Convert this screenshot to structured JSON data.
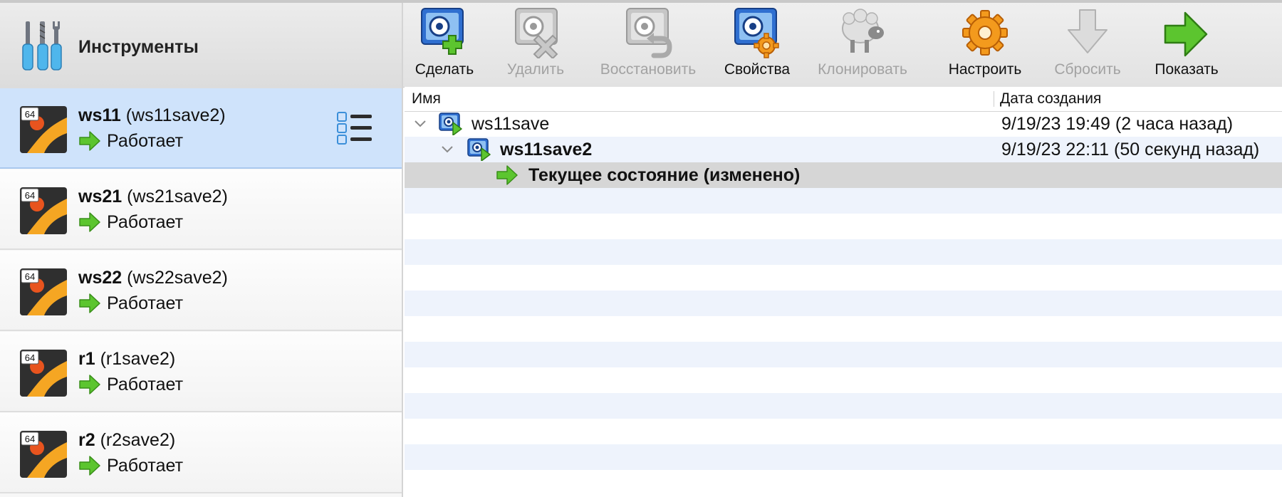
{
  "sidebar": {
    "tools_label": "Инструменты",
    "vms": [
      {
        "name": "ws11",
        "snapshot": "(ws11save2)",
        "state": "Работает",
        "os_badge": "64",
        "selected": true
      },
      {
        "name": "ws21",
        "snapshot": "(ws21save2)",
        "state": "Работает",
        "os_badge": "64"
      },
      {
        "name": "ws22",
        "snapshot": "(ws22save2)",
        "state": "Работает",
        "os_badge": "64"
      },
      {
        "name": "r1",
        "snapshot": "(r1save2)",
        "state": "Работает",
        "os_badge": "64"
      },
      {
        "name": "r2",
        "snapshot": "(r2save2)",
        "state": "Работает",
        "os_badge": "64"
      }
    ]
  },
  "toolbar": {
    "take": {
      "label": "Сделать",
      "icon": "take-snapshot-icon",
      "enabled": true
    },
    "delete": {
      "label": "Удалить",
      "icon": "delete-snapshot-icon",
      "enabled": false
    },
    "restore": {
      "label": "Восстановить",
      "icon": "restore-snapshot-icon",
      "enabled": false
    },
    "properties": {
      "label": "Свойства",
      "icon": "snapshot-properties-icon",
      "enabled": true
    },
    "clone": {
      "label": "Клонировать",
      "icon": "clone-sheep-icon",
      "enabled": false
    },
    "configure": {
      "label": "Настроить",
      "icon": "gear-icon",
      "enabled": true
    },
    "discard": {
      "label": "Сбросить",
      "icon": "discard-arrow-down-icon",
      "enabled": false
    },
    "show": {
      "label": "Показать",
      "icon": "show-arrow-right-icon",
      "enabled": true
    }
  },
  "snapshots": {
    "columns": {
      "name": "Имя",
      "date": "Дата создания"
    },
    "rows": [
      {
        "name": "ws11save",
        "date": "9/19/23 19:49 (2 часа назад)"
      },
      {
        "name": "ws11save2",
        "date": "9/19/23 22:11 (50 секунд назад)"
      },
      {
        "name": "Текущее состояние (изменено)",
        "date": ""
      }
    ]
  },
  "colors": {
    "selection": "#cfe3fb",
    "row_alt": "#eef3fc",
    "current_row": "#d6d6d6",
    "running_arrow": "#5cc52f",
    "gear": "#f39a1d"
  }
}
